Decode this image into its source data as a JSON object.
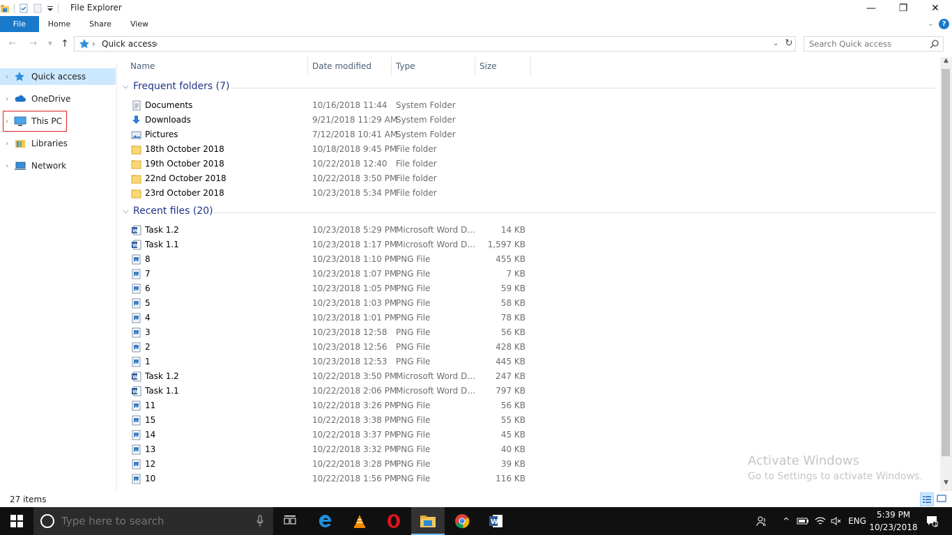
{
  "window": {
    "title": "File Explorer",
    "minimize": "—",
    "maximize": "❐",
    "close": "✕"
  },
  "ribbon": {
    "tabs": [
      "File",
      "Home",
      "Share",
      "View"
    ],
    "help": "?"
  },
  "address": {
    "breadcrumb": "Quick access",
    "search_placeholder": "Search Quick access"
  },
  "nav": {
    "items": [
      {
        "label": "Quick access",
        "icon": "star-icon"
      },
      {
        "label": "OneDrive",
        "icon": "cloud-icon"
      },
      {
        "label": "This PC",
        "icon": "computer-icon"
      },
      {
        "label": "Libraries",
        "icon": "library-icon"
      },
      {
        "label": "Network",
        "icon": "network-icon"
      }
    ]
  },
  "columns": {
    "name": "Name",
    "date": "Date modified",
    "type": "Type",
    "size": "Size"
  },
  "groups": {
    "frequent": "Frequent folders (7)",
    "recent": "Recent files (20)"
  },
  "frequent_folders": [
    {
      "name": "Documents",
      "date": "10/16/2018 11:44",
      "type": "System Folder",
      "icon": "documents-icon"
    },
    {
      "name": "Downloads",
      "date": "9/21/2018 11:29 AM",
      "type": "System Folder",
      "icon": "downloads-icon"
    },
    {
      "name": "Pictures",
      "date": "7/12/2018 10:41 AM",
      "type": "System Folder",
      "icon": "pictures-icon"
    },
    {
      "name": "18th October 2018",
      "date": "10/18/2018 9:45 PM",
      "type": "File folder",
      "icon": "folder-icon"
    },
    {
      "name": "19th October 2018",
      "date": "10/22/2018 12:40",
      "type": "File folder",
      "icon": "folder-icon"
    },
    {
      "name": "22nd October 2018",
      "date": "10/22/2018 3:50 PM",
      "type": "File folder",
      "icon": "folder-icon"
    },
    {
      "name": "23rd October 2018",
      "date": "10/23/2018 5:34 PM",
      "type": "File folder",
      "icon": "folder-icon"
    }
  ],
  "recent_files": [
    {
      "name": "Task 1.2",
      "date": "10/23/2018 5:29 PM",
      "type": "Microsoft Word D...",
      "size": "14 KB",
      "icon": "word-doc-icon"
    },
    {
      "name": "Task 1.1",
      "date": "10/23/2018 1:17 PM",
      "type": "Microsoft Word D...",
      "size": "1,597 KB",
      "icon": "word-doc-icon"
    },
    {
      "name": "8",
      "date": "10/23/2018 1:10 PM",
      "type": "PNG File",
      "size": "455 KB",
      "icon": "png-file-icon"
    },
    {
      "name": "7",
      "date": "10/23/2018 1:07 PM",
      "type": "PNG File",
      "size": "7 KB",
      "icon": "png-file-icon"
    },
    {
      "name": "6",
      "date": "10/23/2018 1:05 PM",
      "type": "PNG File",
      "size": "59 KB",
      "icon": "png-file-icon"
    },
    {
      "name": "5",
      "date": "10/23/2018 1:03 PM",
      "type": "PNG File",
      "size": "58 KB",
      "icon": "png-file-icon"
    },
    {
      "name": "4",
      "date": "10/23/2018 1:01 PM",
      "type": "PNG File",
      "size": "78 KB",
      "icon": "png-file-icon"
    },
    {
      "name": "3",
      "date": "10/23/2018 12:58",
      "type": "PNG File",
      "size": "56 KB",
      "icon": "png-file-icon"
    },
    {
      "name": "2",
      "date": "10/23/2018 12:56",
      "type": "PNG File",
      "size": "428 KB",
      "icon": "png-file-icon"
    },
    {
      "name": "1",
      "date": "10/23/2018 12:53",
      "type": "PNG File",
      "size": "445 KB",
      "icon": "png-file-icon"
    },
    {
      "name": "Task 1.2",
      "date": "10/22/2018 3:50 PM",
      "type": "Microsoft Word D...",
      "size": "247 KB",
      "icon": "word-doc-icon"
    },
    {
      "name": "Task 1.1",
      "date": "10/22/2018 2:06 PM",
      "type": "Microsoft Word D...",
      "size": "797 KB",
      "icon": "word-doc-icon"
    },
    {
      "name": "11",
      "date": "10/22/2018 3:26 PM",
      "type": "PNG File",
      "size": "56 KB",
      "icon": "png-file-icon"
    },
    {
      "name": "15",
      "date": "10/22/2018 3:38 PM",
      "type": "PNG File",
      "size": "55 KB",
      "icon": "png-file-icon"
    },
    {
      "name": "14",
      "date": "10/22/2018 3:37 PM",
      "type": "PNG File",
      "size": "45 KB",
      "icon": "png-file-icon"
    },
    {
      "name": "13",
      "date": "10/22/2018 3:32 PM",
      "type": "PNG File",
      "size": "40 KB",
      "icon": "png-file-icon"
    },
    {
      "name": "12",
      "date": "10/22/2018 3:28 PM",
      "type": "PNG File",
      "size": "39 KB",
      "icon": "png-file-icon"
    },
    {
      "name": "10",
      "date": "10/22/2018 1:56 PM",
      "type": "PNG File",
      "size": "116 KB",
      "icon": "png-file-icon"
    }
  ],
  "status": {
    "items_count": "27 items"
  },
  "watermark": {
    "line1": "Activate Windows",
    "line2": "Go to Settings to activate Windows."
  },
  "taskbar": {
    "search_placeholder": "Type here to search",
    "apps": [
      "task-view-icon",
      "edge-icon",
      "vlc-icon",
      "opera-icon",
      "file-explorer-icon",
      "chrome-icon",
      "word-icon"
    ],
    "language": "ENG",
    "time": "5:39 PM",
    "date": "10/23/2018",
    "notification_count": "1"
  },
  "colors": {
    "accent": "#1979ca",
    "selection": "#cce8ff",
    "highlight_box": "#d61f1f",
    "group_heading": "#1e3287",
    "taskbar": "#101010"
  }
}
